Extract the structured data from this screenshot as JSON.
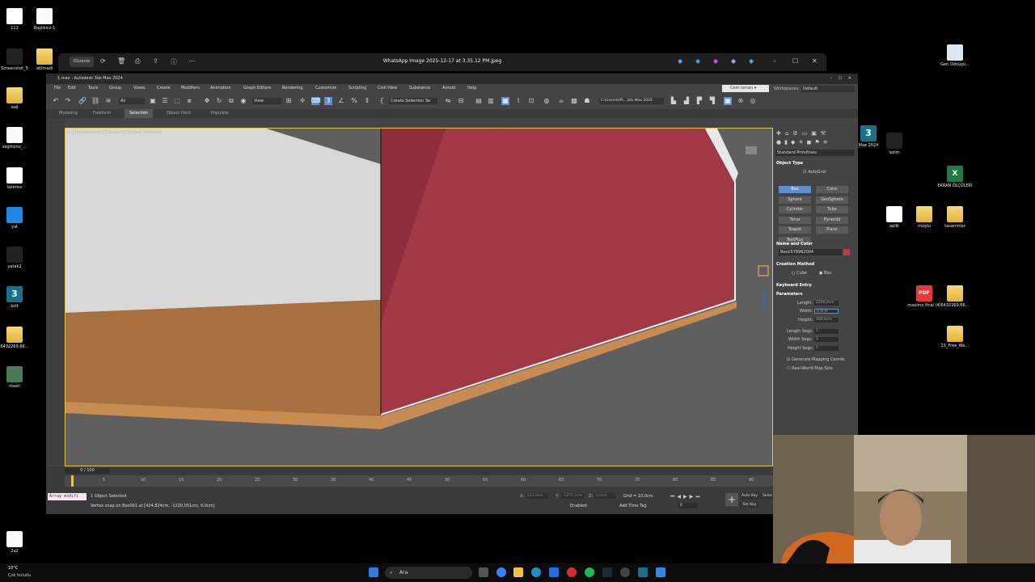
{
  "desktop": {
    "left_icons": [
      {
        "label": "112",
        "kind": "app"
      },
      {
        "label": "Başlıksız-1",
        "kind": "doc"
      },
      {
        "label": "Screenshot_5",
        "kind": "dark"
      },
      {
        "label": "atilmadi",
        "kind": "folder"
      },
      {
        "label": "sad",
        "kind": "folder"
      },
      {
        "label": "segmono_...",
        "kind": "doc"
      },
      {
        "label": "lazimss",
        "kind": "app"
      },
      {
        "label": "yat",
        "kind": "shield"
      },
      {
        "label": "yatak2",
        "kind": "dark"
      },
      {
        "label": "kolt",
        "kind": "max"
      },
      {
        "label": "6432269.66...",
        "kind": "folder"
      },
      {
        "label": "maxii",
        "kind": "img"
      },
      {
        "label": "2a2",
        "kind": "doc"
      }
    ],
    "right_icons": [
      {
        "label": "Geri Dönüşü...",
        "kind": "bin"
      },
      {
        "label": "Max 2024",
        "kind": "max"
      },
      {
        "label": "lazim",
        "kind": "dark"
      },
      {
        "label": "EKRAN ÖLÇÜLERİ",
        "kind": "xls"
      },
      {
        "label": "aplik",
        "kind": "app"
      },
      {
        "label": "müştü",
        "kind": "folder"
      },
      {
        "label": "tasarımlar",
        "kind": "folder"
      },
      {
        "label": "maximo final (4)",
        "kind": "pdf"
      },
      {
        "label": "6432269.66...",
        "kind": "folder"
      },
      {
        "label": "21_Free_We...",
        "kind": "folder"
      }
    ]
  },
  "viewer": {
    "title": "WhatsApp Image 2025-12-17 at 3.35.12 PM.jpeg",
    "edit_label": "Düzenle"
  },
  "max": {
    "title": "1.max - Autodesk 3ds Max 2024",
    "menus": [
      "File",
      "Edit",
      "Tools",
      "Group",
      "Views",
      "Create",
      "Modifiers",
      "Animation",
      "Graph Editors",
      "Rendering",
      "Customize",
      "Scripting",
      "Civil View",
      "Substance",
      "Arnold",
      "Help"
    ],
    "user": "Cem Isman",
    "workspaces_label": "Workspaces:",
    "workspace": "Default",
    "filter": "All",
    "view": "View",
    "selection_set": "Create Selection Se",
    "path": "C:\\Users\\HP\\...3ds Max 2024",
    "ribbon_tabs": [
      "Modeling",
      "Freeform",
      "Selection",
      "Object Paint",
      "Populate"
    ],
    "viewport_label": "[+] [Perspective] [Standard] [Default Shading]",
    "command_panel": {
      "category": "Standard Primitives",
      "object_type": "Object Type",
      "autogrid": "AutoGrid",
      "buttons": [
        "Box",
        "Cone",
        "Sphere",
        "GeoSphere",
        "Cylinder",
        "Tube",
        "Torus",
        "Pyramid",
        "Teapot",
        "Plane",
        "TextPlus"
      ],
      "name_color": "Name and Color",
      "object_name": "Box1578962004",
      "object_color": "#c0394b",
      "creation_method": "Creation Method",
      "cube": "Cube",
      "box": "Box",
      "keyboard_entry": "Keyboard Entry",
      "parameters": "Parameters",
      "length_label": "Length:",
      "length": "2200,0cm",
      "width_label": "Width:",
      "width": "0,0cm",
      "height_label": "Height:",
      "height": "500,0cm",
      "length_segs_label": "Length Segs:",
      "length_segs": "1",
      "width_segs_label": "Width Segs:",
      "width_segs": "1",
      "height_segs_label": "Height Segs:",
      "height_segs": "1",
      "gen_mapping": "Generate Mapping Coords.",
      "real_world": "Real-World Map Size"
    },
    "timeline": {
      "frame": "0 / 100",
      "ticks": [
        "5",
        "10",
        "15",
        "20",
        "25",
        "30",
        "35",
        "40",
        "45",
        "50",
        "55",
        "60",
        "65",
        "70",
        "75",
        "80",
        "85",
        "90"
      ]
    },
    "status": {
      "script_box": "Array modifi",
      "selected": "1 Object Selected",
      "prompt": "Vertex snap on Box001 at [424,824cm, -1220,051cm, 0,0cm]",
      "x_label": "X:",
      "x": "223,0cm",
      "y_label": "Y:",
      "y": "-1277,1cm",
      "z_label": "Z:",
      "z": "0,0cm",
      "grid": "Grid = 10,0cm",
      "enabled": "Enabled:",
      "add_time_tag": "Add Time Tag",
      "auto_key": "Auto Key",
      "set_key": "Set Key",
      "selected_btn": "Selec",
      "frame_field": "0"
    }
  },
  "taskbar": {
    "search": "Ara",
    "weather_temp": "10°C",
    "weather_text": "Çok bulutlu"
  },
  "colors": {
    "red_wall": "#a83542",
    "wood": "#b27a45",
    "white_wall": "#d9d9d9",
    "accent": "#e6c651"
  }
}
